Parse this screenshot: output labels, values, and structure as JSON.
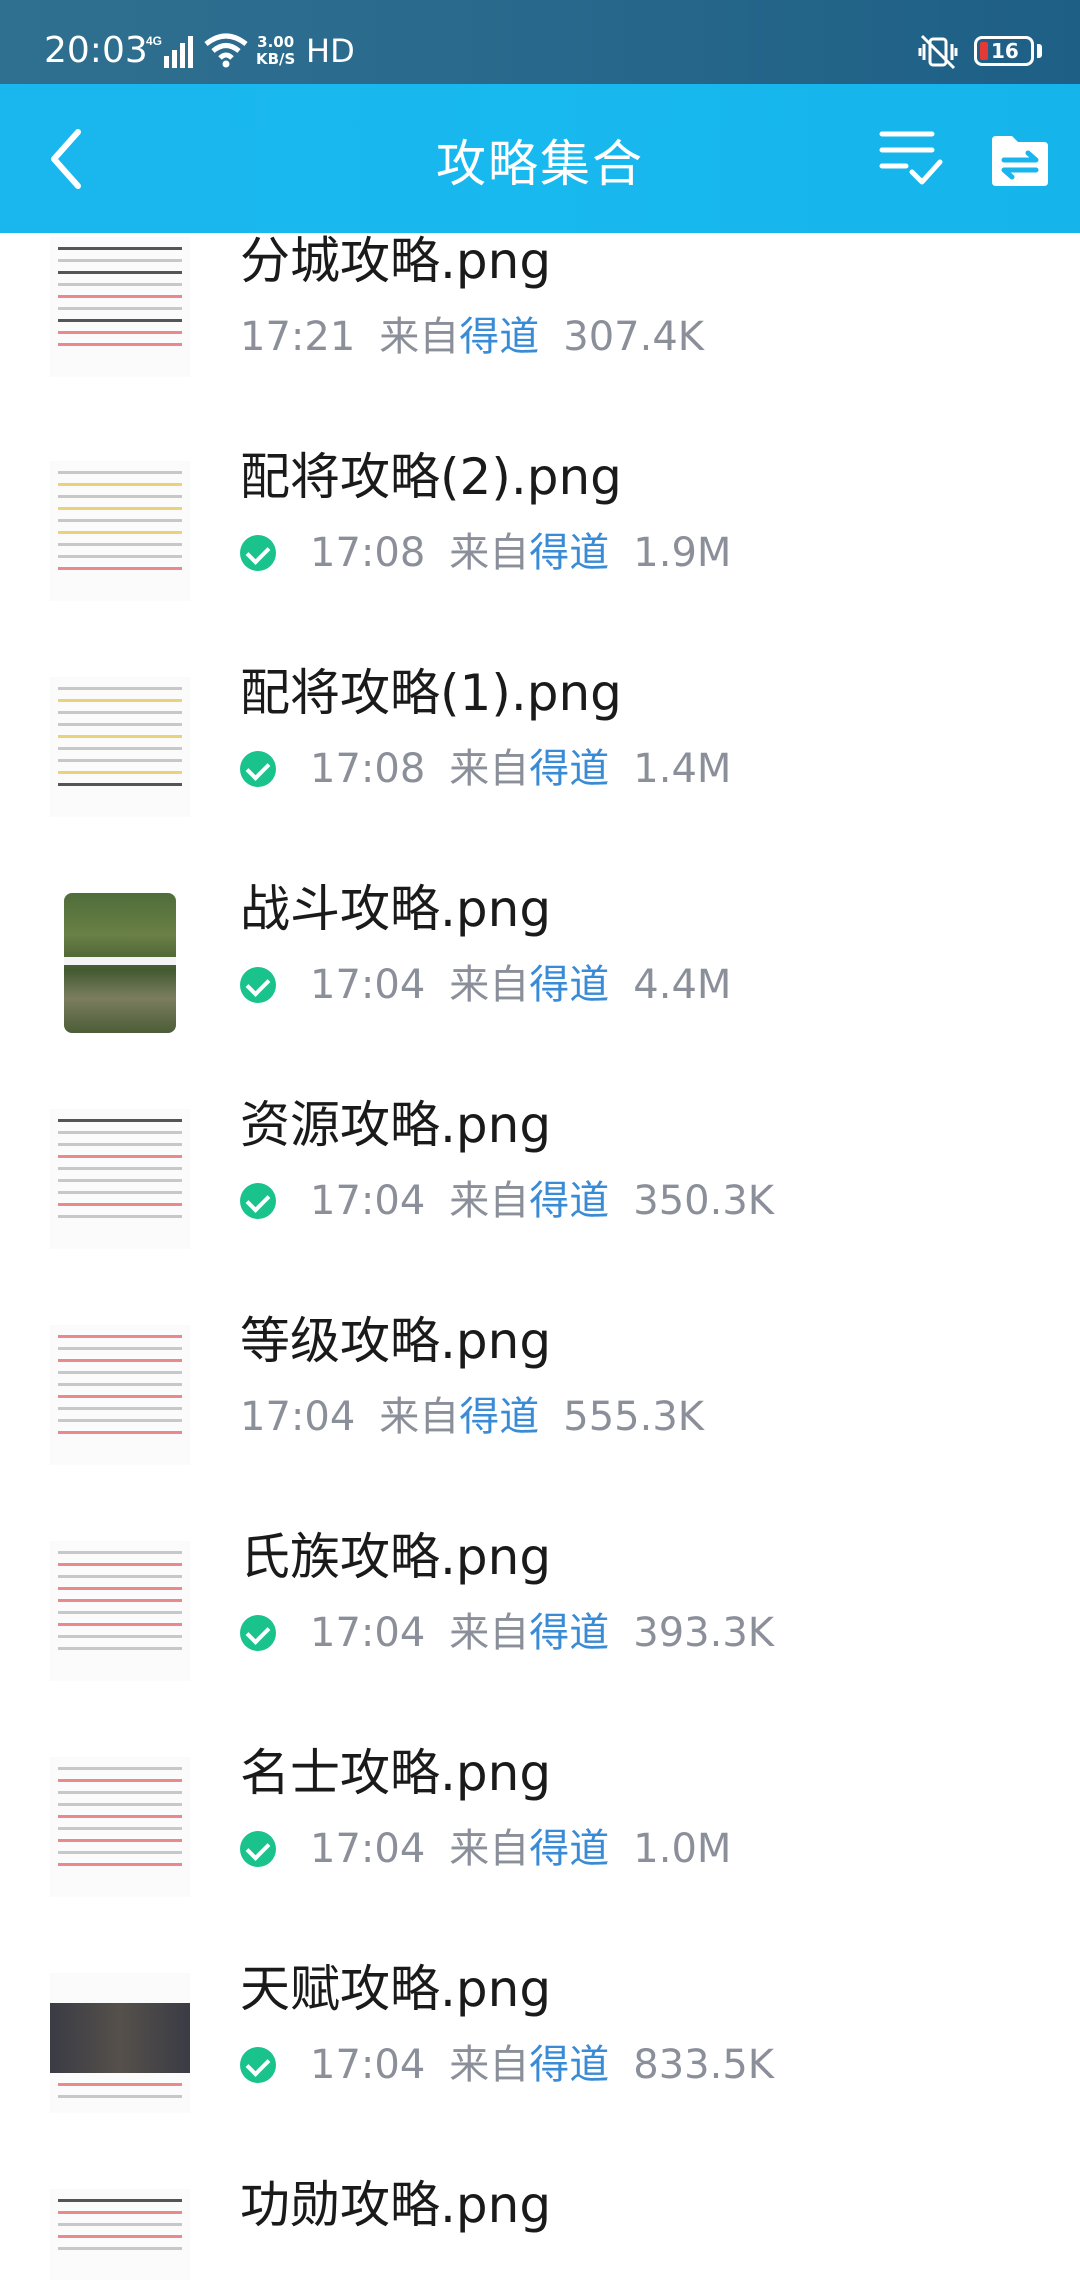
{
  "status_bar": {
    "time": "20:03",
    "network": "4G",
    "speed_value": "3.00",
    "speed_unit": "KB/S",
    "hd": "HD",
    "battery": "16"
  },
  "header": {
    "title": "攻略集合",
    "back_icon": "chevron-left-icon",
    "batch_icon": "list-check-icon",
    "folder_icon": "folder-transfer-icon",
    "color": "#17b6ed"
  },
  "files": [
    {
      "name": "分城攻略.png",
      "time": "17:21",
      "from": "来自",
      "source": "得道",
      "size": "307.4K",
      "checked": false
    },
    {
      "name": "配将攻略(2).png",
      "time": "17:08",
      "from": "来自",
      "source": "得道",
      "size": "1.9M",
      "checked": true
    },
    {
      "name": "配将攻略(1).png",
      "time": "17:08",
      "from": "来自",
      "source": "得道",
      "size": "1.4M",
      "checked": true
    },
    {
      "name": "战斗攻略.png",
      "time": "17:04",
      "from": "来自",
      "source": "得道",
      "size": "4.4M",
      "checked": true
    },
    {
      "name": "资源攻略.png",
      "time": "17:04",
      "from": "来自",
      "source": "得道",
      "size": "350.3K",
      "checked": true
    },
    {
      "name": "等级攻略.png",
      "time": "17:04",
      "from": "来自",
      "source": "得道",
      "size": "555.3K",
      "checked": false
    },
    {
      "name": "氏族攻略.png",
      "time": "17:04",
      "from": "来自",
      "source": "得道",
      "size": "393.3K",
      "checked": true
    },
    {
      "name": "名士攻略.png",
      "time": "17:04",
      "from": "来自",
      "source": "得道",
      "size": "1.0M",
      "checked": true
    },
    {
      "name": "天赋攻略.png",
      "time": "17:04",
      "from": "来自",
      "source": "得道",
      "size": "833.5K",
      "checked": true
    },
    {
      "name": "功勋攻略.png",
      "time": "",
      "from": "",
      "source": "",
      "size": "",
      "checked": false
    }
  ],
  "colors": {
    "source_link": "#3a8bd6",
    "check": "#1ac28c",
    "meta_text": "#8a8f99"
  }
}
